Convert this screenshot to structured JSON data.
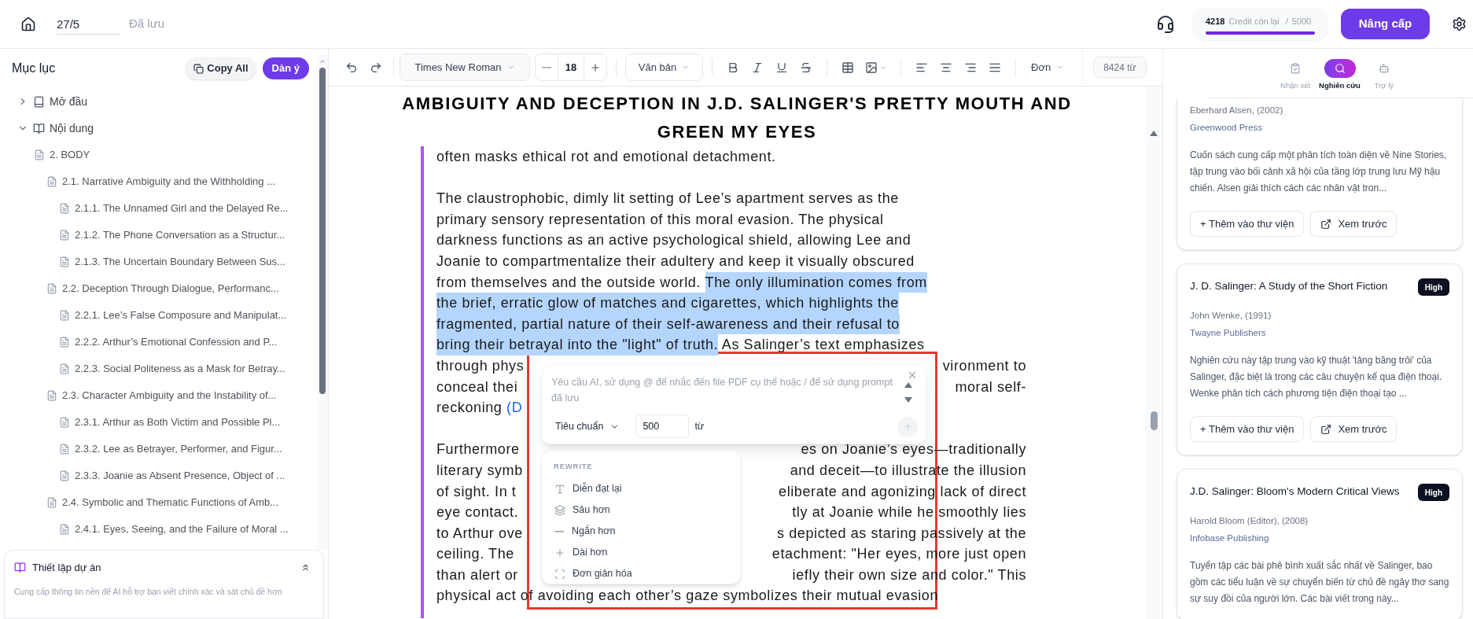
{
  "topbar": {
    "document_name": "27/5",
    "save_status": "Đã lưu",
    "credits": {
      "used": "4218",
      "label": "Credit còn lại",
      "separator": "/",
      "total": "5000",
      "level": 1
    },
    "upgrade_button": "Nâng cấp"
  },
  "outline": {
    "title": "Mục lục",
    "copy_button": "Copy All",
    "outline_button": "Dàn ý",
    "items": [
      {
        "label": "Mở đầu",
        "kind": "part",
        "expanded": false
      },
      {
        "label": "Nội dung",
        "kind": "part",
        "expanded": true,
        "children": [
          {
            "label": "2. BODY",
            "kind": "section",
            "children": [
              {
                "label": "2.1. Narrative Ambiguity and the Withholding ...",
                "kind": "section",
                "children": [
                  {
                    "label": "2.1.1. The Unnamed Girl and the Delayed Re...",
                    "kind": "section"
                  },
                  {
                    "label": "2.1.2. The Phone Conversation as a Structur...",
                    "kind": "section"
                  },
                  {
                    "label": "2.1.3. The Uncertain Boundary Between Sus...",
                    "kind": "section"
                  }
                ]
              },
              {
                "label": "2.2. Deception Through Dialogue, Performanc...",
                "kind": "section",
                "children": [
                  {
                    "label": "2.2.1. Lee’s False Composure and Manipulat...",
                    "kind": "section"
                  },
                  {
                    "label": "2.2.2. Arthur’s Emotional Confession and P...",
                    "kind": "section"
                  },
                  {
                    "label": "2.2.3. Social Politeness as a Mask for Betray...",
                    "kind": "section"
                  }
                ]
              },
              {
                "label": "2.3. Character Ambiguity and the Instability of...",
                "kind": "section",
                "children": [
                  {
                    "label": "2.3.1. Arthur as Both Victim and Possible Pl...",
                    "kind": "section"
                  },
                  {
                    "label": "2.3.2. Lee as Betrayer, Performer, and Figur...",
                    "kind": "section"
                  },
                  {
                    "label": "2.3.3. Joanie as Absent Presence, Object of ...",
                    "kind": "section"
                  }
                ]
              },
              {
                "label": "2.4. Symbolic and Thematic Functions of Amb...",
                "kind": "section",
                "children": [
                  {
                    "label": "2.4.1. Eyes, Seeing, and the Failure of Moral ...",
                    "kind": "section"
                  }
                ]
              }
            ]
          }
        ]
      }
    ]
  },
  "project_setup": {
    "title": "Thiết lập dự án",
    "description": "Cung cấp thông tin nền để AI hỗ trợ bạn viết chính xác và sát chủ đề hơn"
  },
  "toolbar": {
    "font": "Times New Roman",
    "font_size": "18",
    "style": "Văn bản",
    "line_spacing": "Đơn",
    "word_count": "8424 từ"
  },
  "document": {
    "title": "AMBIGUITY AND DECEPTION IN J.D. SALINGER'S PRETTY MOUTH AND GREEN MY EYES",
    "paragraphs": [
      {
        "lines": [
          {
            "segments": [
              {
                "text": "often masks ethical rot and emotional detachment.",
                "kind": "plain"
              }
            ]
          }
        ]
      },
      {
        "lines": [
          {
            "segments": [
              {
                "text": "The claustrophobic, dimly lit setting of Lee’s apartment serves as the",
                "kind": "plain"
              }
            ]
          },
          {
            "segments": [
              {
                "text": "primary sensory representation of this moral evasion. The physical",
                "kind": "plain"
              }
            ]
          },
          {
            "segments": [
              {
                "text": "darkness functions as an active psychological shield, allowing Lee and",
                "kind": "plain"
              }
            ]
          },
          {
            "segments": [
              {
                "text": "Joanie to compartmentalize their adultery and keep it visually obscured",
                "kind": "plain"
              }
            ]
          },
          {
            "segments": [
              {
                "text": "from themselves and the outside world. ",
                "kind": "plain"
              },
              {
                "text": "The only illumination comes from",
                "kind": "highlight"
              }
            ]
          },
          {
            "segments": [
              {
                "text": "the brief, erratic glow of matches and cigarettes, which highlights the",
                "kind": "highlight"
              }
            ]
          },
          {
            "segments": [
              {
                "text": "fragmented, partial nature of their self-awareness and their refusal to",
                "kind": "highlight"
              }
            ]
          },
          {
            "segments": [
              {
                "text": "bring their betrayal into the \"light\" of truth.",
                "kind": "highlight"
              },
              {
                "text": " As Salinger’s text emphasizes",
                "kind": "plain"
              }
            ]
          },
          {
            "segments": [
              {
                "text": "through phys",
                "kind": "plain"
              }
            ],
            "right": "vironment to"
          },
          {
            "segments": [
              {
                "text": "conceal thei",
                "kind": "plain"
              }
            ],
            "right": "moral self-"
          },
          {
            "segments": [
              {
                "text": "reckoning ",
                "kind": "plain"
              },
              {
                "text": "(D",
                "kind": "link"
              }
            ]
          }
        ]
      },
      {
        "lines": [
          {
            "segments": [
              {
                "text": "Furthermore",
                "kind": "plain"
              }
            ],
            "right": "es on Joanie’s eyes—traditionally"
          },
          {
            "segments": [
              {
                "text": "literary symb",
                "kind": "plain"
              }
            ],
            "right": "and deceit—to illustrate the illusion"
          },
          {
            "segments": [
              {
                "text": "of sight. In t",
                "kind": "plain"
              }
            ],
            "right": "eliberate and agonizing lack of direct"
          },
          {
            "segments": [
              {
                "text": "eye contact.",
                "kind": "plain"
              }
            ],
            "right": "tly at Joanie while he smoothly lies"
          },
          {
            "segments": [
              {
                "text": "to Arthur ove",
                "kind": "plain"
              }
            ],
            "right": "s depicted as staring passively at the"
          },
          {
            "segments": [
              {
                "text": "ceiling. The",
                "kind": "plain"
              }
            ],
            "right": "etachment: \"Her eyes, more just open"
          },
          {
            "segments": [
              {
                "text": "than alert or",
                "kind": "plain"
              }
            ],
            "right": "iefly their own size and color.\" This"
          },
          {
            "segments": [
              {
                "text": "physical act of avoiding each other’s gaze symbolizes their mutual evasion",
                "kind": "plain"
              }
            ]
          }
        ]
      }
    ]
  },
  "ai_prompt": {
    "placeholder": "Yêu cầu AI, sử dụng @ để nhắc đến file PDF cụ thể hoặc / để sử dụng prompt đã lưu",
    "mode": "Tiêu chuẩn",
    "word_limit": "500",
    "word_unit": "từ"
  },
  "rewrite_menu": {
    "heading": "REWRITE",
    "items": [
      {
        "label": "Diễn đạt lại",
        "kind": "rephrase"
      },
      {
        "label": "Sâu hơn",
        "kind": "deeper"
      },
      {
        "label": "Ngắn hơn",
        "kind": "shorter"
      },
      {
        "label": "Dài hơn",
        "kind": "longer"
      },
      {
        "label": "Đơn giản hóa",
        "kind": "simplify"
      }
    ]
  },
  "research_panel": {
    "tabs": [
      {
        "label": "Nhận xét",
        "kind": "review",
        "selected": false
      },
      {
        "label": "Nghiên cứu",
        "kind": "research",
        "selected": true
      },
      {
        "label": "Trợ lý",
        "kind": "assistant",
        "selected": false
      }
    ],
    "sources": [
      {
        "author": "Eberhard Alsen, (2002)",
        "publisher": "Greenwood Press",
        "summary": "Cuốn sách cung cấp một phân tích toàn diện về Nine Stories, tập trung vào bối cảnh xã hội của tầng lớp trung lưu Mỹ hậu chiến. Alsen giải thích cách các nhân vật tron...",
        "add_button": "+ Thêm vào thư viện",
        "preview_button": "Xem trước"
      },
      {
        "title": "J. D. Salinger: A Study of the Short Fiction",
        "badge": "High",
        "author": "John Wenke, (1991)",
        "publisher": "Twayne Publishers",
        "summary": "Nghiên cứu này tập trung vào kỹ thuật 'tảng băng trôi' của Salinger, đặc biệt là trong các câu chuyện kể qua điện thoại. Wenke phân tích cách phương tiện điện thoại tạo ...",
        "add_button": "+ Thêm vào thư viện",
        "preview_button": "Xem trước"
      },
      {
        "title": "J.D. Salinger: Bloom's Modern Critical Views",
        "badge": "High",
        "author": "Harold Bloom (Editor), (2008)",
        "publisher": "Infobase Publishing",
        "summary": "Tuyển tập các bài phê bình xuất sắc nhất về Salinger, bao gồm các tiểu luận về sự chuyển biến từ chủ đề ngây thơ sang sự suy đồi của người lớn. Các bài viết trong này..."
      }
    ]
  }
}
